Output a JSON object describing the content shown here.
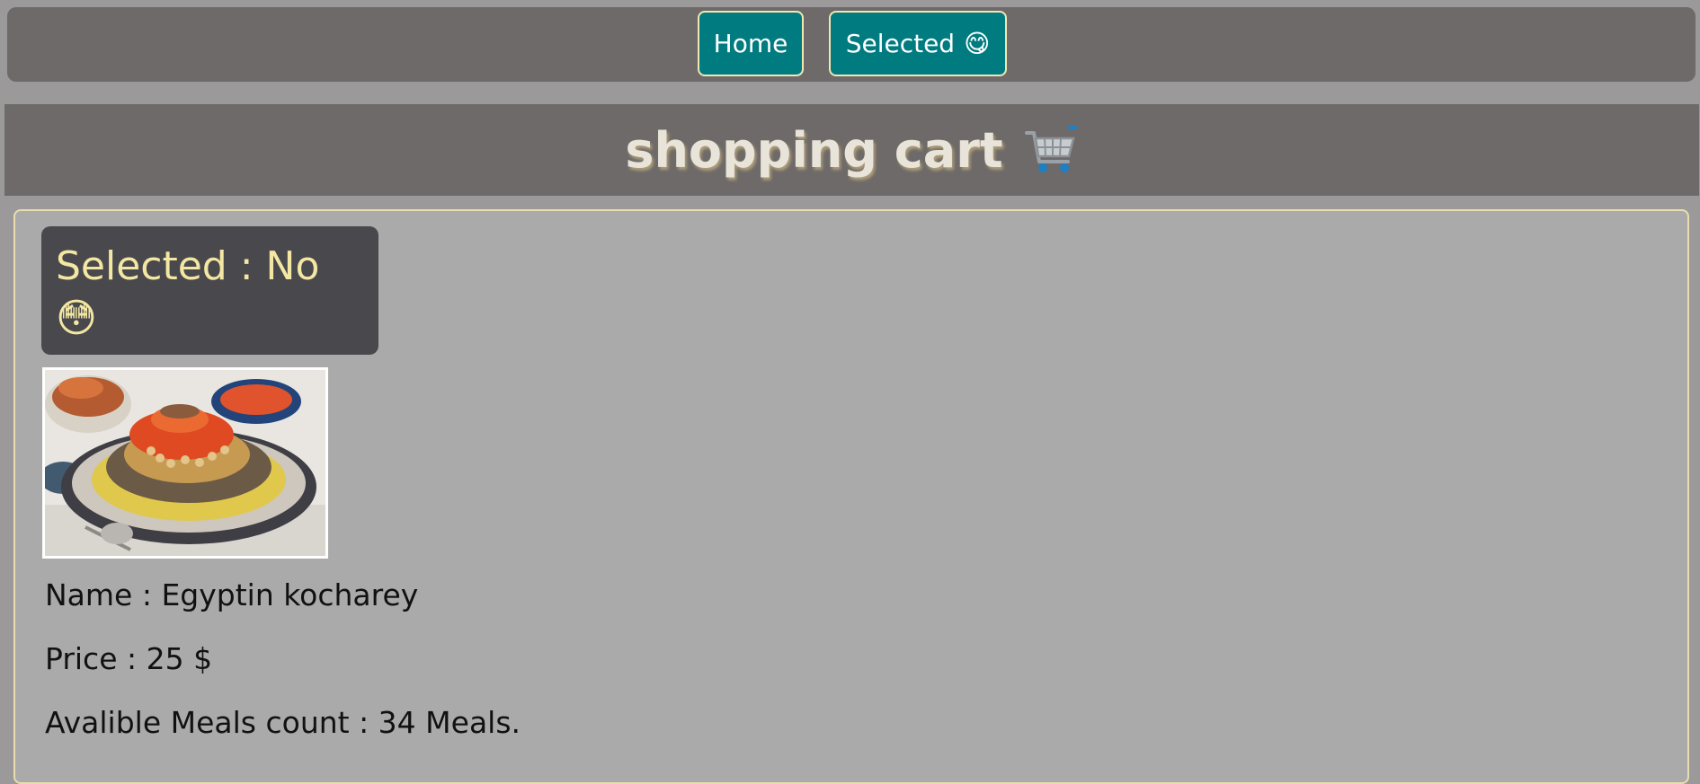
{
  "nav": {
    "home_label": "Home",
    "selected_label": "Selected",
    "selected_emoji": "😋"
  },
  "header": {
    "title": "shopping cart",
    "icon": "shopping-cart-icon"
  },
  "item": {
    "selected_text": "Selected : No",
    "selected_emoji": "😳",
    "image": "koshary-plate-image",
    "name_line": "Name : Egyptin kocharey",
    "price_line": "Price : 25 $",
    "count_line": "Avalible Meals count : 34 Meals."
  },
  "colors": {
    "page_bg": "#9b9999",
    "bar_bg": "#6e6a69",
    "button_bg": "#007b80",
    "button_border": "#f2e6b3",
    "content_bg": "#abaaaa",
    "status_bg": "#49494d",
    "status_text": "#f4e7a3"
  }
}
